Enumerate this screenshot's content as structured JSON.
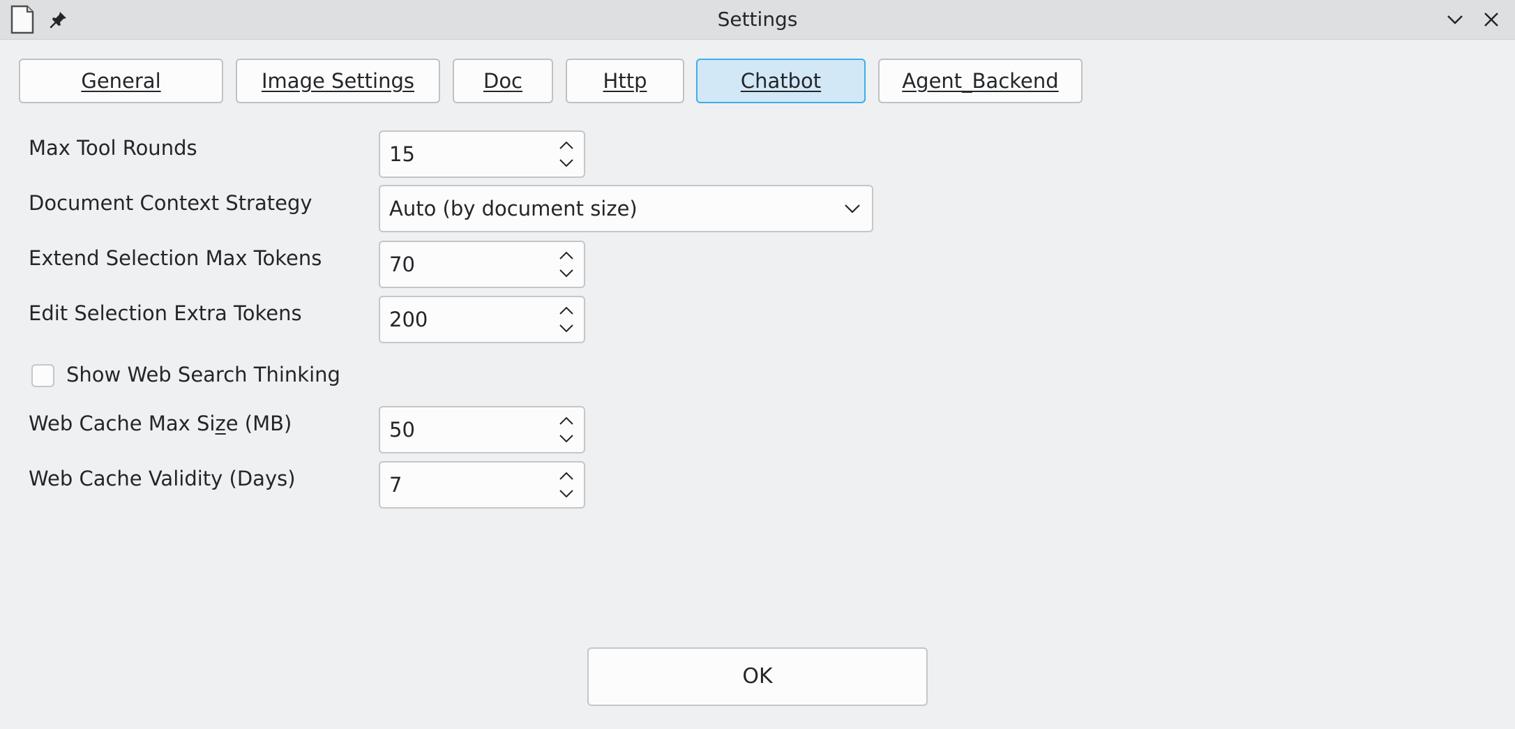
{
  "window": {
    "title": "Settings"
  },
  "titlebar_icons": [
    "document-icon",
    "pin-icon",
    "chevron-down-icon",
    "close-icon"
  ],
  "tabs": [
    {
      "label": "General",
      "active": false
    },
    {
      "label": "Image Settings",
      "active": false
    },
    {
      "label": "Doc",
      "active": false
    },
    {
      "label": "Http",
      "active": false
    },
    {
      "label": "Chatbot",
      "active": true
    },
    {
      "label": "Agent_Backend",
      "active": false
    }
  ],
  "fields": {
    "max_tool_rounds": {
      "label": "Max Tool Rounds",
      "value": "15"
    },
    "document_context_strategy": {
      "label": "Document Context Strategy",
      "value": "Auto (by document size)"
    },
    "extend_selection_max_tokens": {
      "label": "Extend Selection Max Tokens",
      "value": "70"
    },
    "edit_selection_extra_tokens": {
      "label": "Edit Selection Extra Tokens",
      "value": "200"
    },
    "show_web_search_thinking": {
      "label": "Show Web Search Thinking",
      "checked": false
    },
    "web_cache_max_size": {
      "label_pre": "Web Cache Max Si",
      "label_ul": "z",
      "label_post": "e (MB)",
      "value": "50"
    },
    "web_cache_validity": {
      "label": "Web Cache Validity (Days)",
      "value": "7"
    }
  },
  "buttons": {
    "ok": "OK"
  },
  "colors": {
    "accent": "#3daee9",
    "active_tab_bg": "#d3e8f7",
    "window_bg": "#eff0f1"
  }
}
